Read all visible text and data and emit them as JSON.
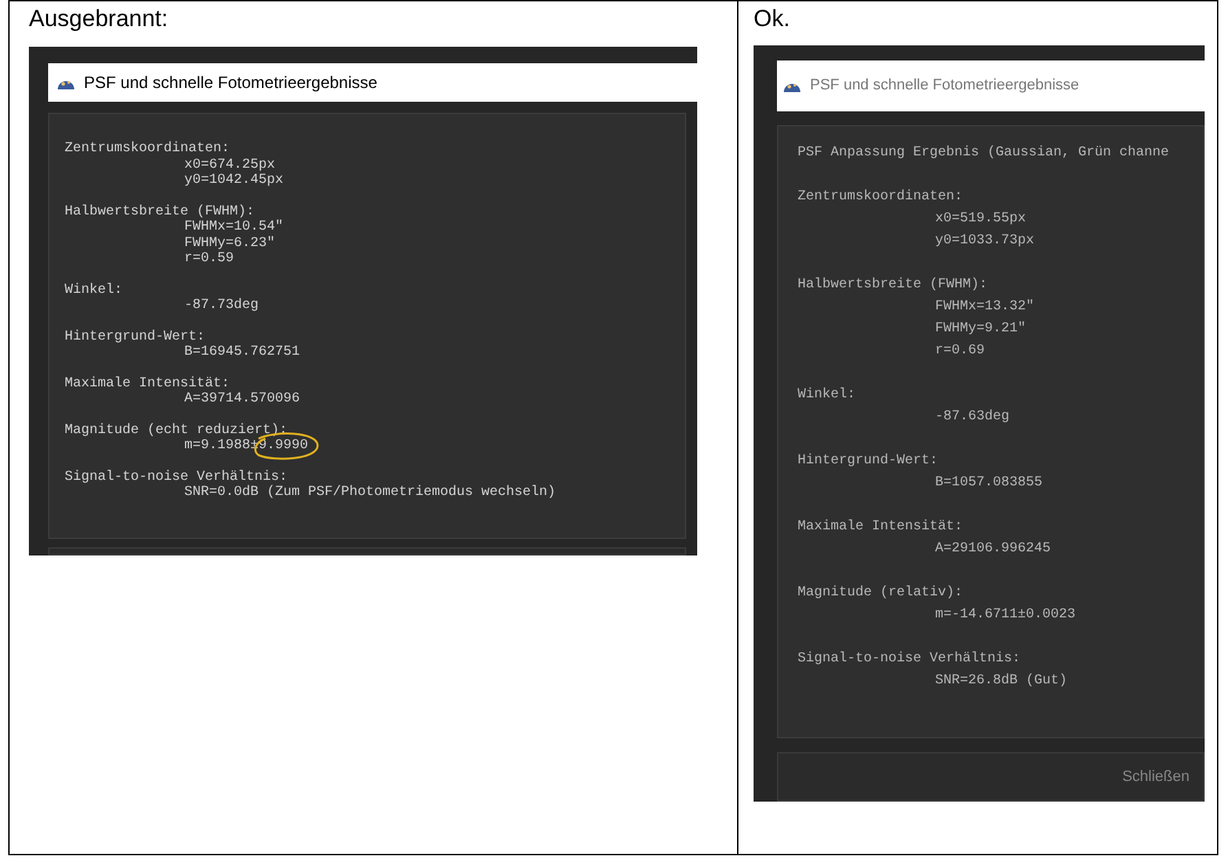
{
  "panels": [
    {
      "label": "Ausgebrannt:",
      "window": {
        "title": "PSF und schnelle Fotometrieergebnisse"
      },
      "groups": [
        {
          "heading": "Zentrumskoordinaten:",
          "values": [
            {
              "text": "x0=674.25px"
            },
            {
              "text": "y0=1042.45px"
            }
          ]
        },
        {
          "heading": "Halbwertsbreite (FWHM):",
          "values": [
            {
              "text": "FWHMx=10.54\""
            },
            {
              "text": "FWHMy=6.23\""
            },
            {
              "text": "r=0.59"
            }
          ]
        },
        {
          "heading": "Winkel:",
          "values": [
            {
              "text": "-87.73deg"
            }
          ]
        },
        {
          "heading": "Hintergrund-Wert:",
          "values": [
            {
              "text": "B=16945.762751"
            }
          ]
        },
        {
          "heading": "Maximale Intensität:",
          "values": [
            {
              "text": "A=39714.570096"
            }
          ]
        },
        {
          "heading": "Magnitude (echt reduziert):",
          "values": [
            {
              "text": "m=9.1988±",
              "highlight": "9.9990"
            }
          ]
        },
        {
          "heading": "Signal-to-noise Verhältnis:",
          "values": [
            {
              "text": "SNR=0.0dB (Zum PSF/Photometriemodus wechseln)"
            }
          ]
        }
      ]
    },
    {
      "label": "Ok.",
      "window": {
        "title": "PSF und schnelle Fotometrieergebnisse"
      },
      "result_line": "PSF Anpassung Ergebnis (Gaussian, Grün channe",
      "groups": [
        {
          "heading": "Zentrumskoordinaten:",
          "values": [
            {
              "text": "x0=519.55px"
            },
            {
              "text": "y0=1033.73px"
            }
          ]
        },
        {
          "heading": "Halbwertsbreite (FWHM):",
          "values": [
            {
              "text": "FWHMx=13.32\""
            },
            {
              "text": "FWHMy=9.21\""
            },
            {
              "text": "r=0.69"
            }
          ]
        },
        {
          "heading": "Winkel:",
          "values": [
            {
              "text": "-87.63deg"
            }
          ]
        },
        {
          "heading": "Hintergrund-Wert:",
          "values": [
            {
              "text": "B=1057.083855"
            }
          ]
        },
        {
          "heading": "Maximale Intensität:",
          "values": [
            {
              "text": "A=29106.996245"
            }
          ]
        },
        {
          "heading": "Magnitude (relativ):",
          "values": [
            {
              "text": "m=-14.6711±0.0023"
            }
          ]
        },
        {
          "heading": "Signal-to-noise Verhältnis:",
          "values": [
            {
              "text": "SNR=26.8dB (Gut)"
            }
          ]
        }
      ],
      "close_button": "Schließen"
    }
  ]
}
